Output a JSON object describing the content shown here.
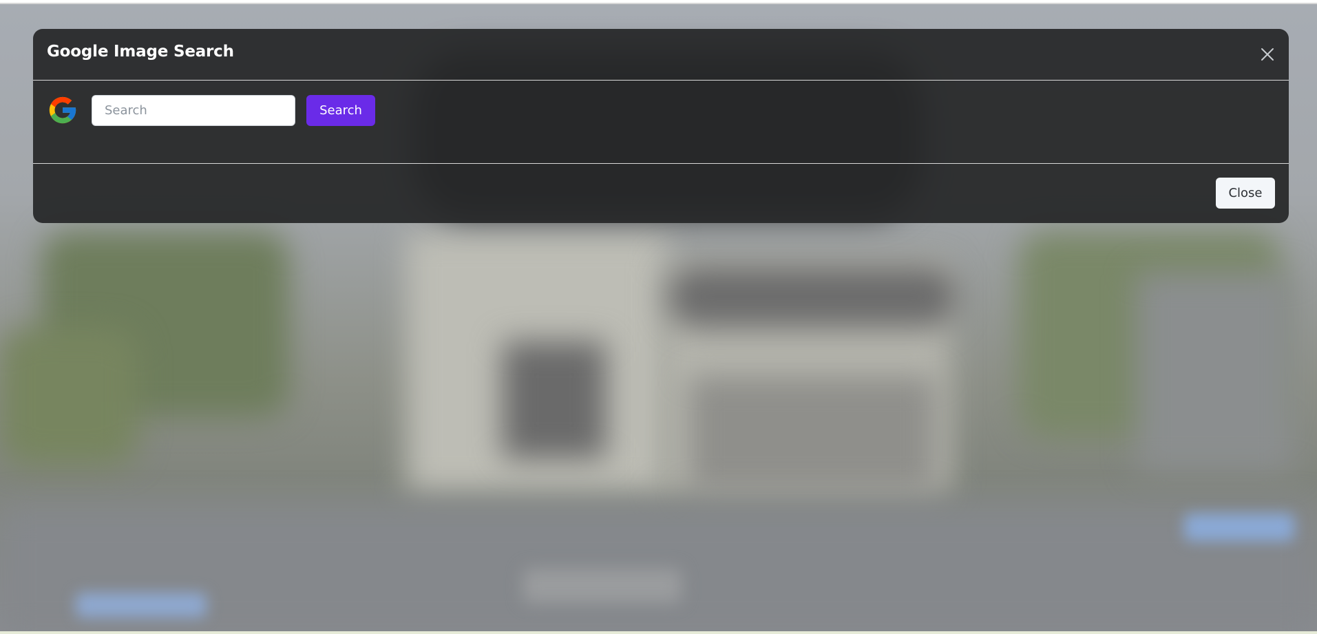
{
  "modal": {
    "title": "Google Image Search",
    "search_placeholder": "Search",
    "search_value": "",
    "search_button_label": "Search",
    "close_button_label": "Close"
  },
  "icons": {
    "logo": "google-logo-icon",
    "close": "close-icon"
  },
  "colors": {
    "primary_button": "#6a2be8",
    "modal_background": "#262728",
    "close_button_background": "#f3f6f9"
  }
}
